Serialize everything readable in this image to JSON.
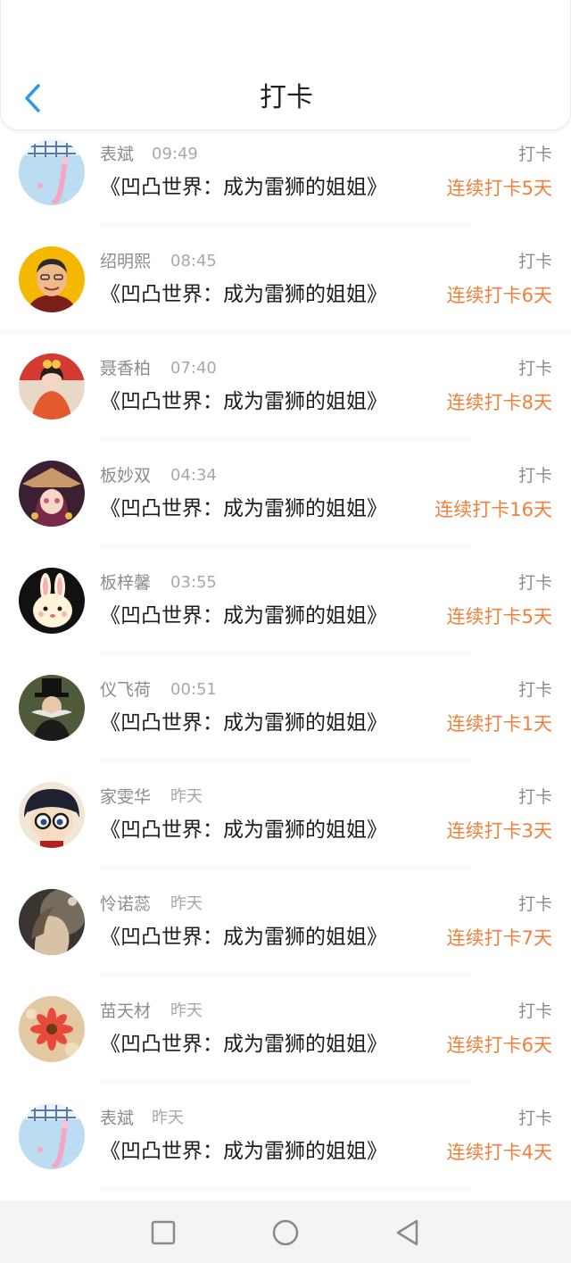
{
  "header": {
    "title": "打卡"
  },
  "colors": {
    "accent_orange": "#f0813c",
    "name_gray": "#8c8c8c",
    "back_blue": "#2b9be8"
  },
  "entries": [
    {
      "name": "表斌",
      "time": "09:49",
      "book": "《凹凸世界：成为雷狮的姐姐》",
      "action": "打卡",
      "streak": "连续打卡5天",
      "avatar_icon": "cherry-blossom-avatar"
    },
    {
      "name": "绍明熙",
      "time": "08:45",
      "book": "《凹凸世界：成为雷狮的姐姐》",
      "action": "打卡",
      "streak": "连续打卡6天",
      "avatar_icon": "cartoon-man-avatar"
    },
    {
      "name": "聂香柏",
      "time": "07:40",
      "book": "《凹凸世界：成为雷狮的姐姐》",
      "action": "打卡",
      "streak": "连续打卡8天",
      "avatar_icon": "doll-avatar"
    },
    {
      "name": "板妙双",
      "time": "04:34",
      "book": "《凹凸世界：成为雷狮的姐姐》",
      "action": "打卡",
      "streak": "连续打卡16天",
      "avatar_icon": "anime-girl-avatar"
    },
    {
      "name": "板梓馨",
      "time": "03:55",
      "book": "《凹凸世界：成为雷狮的姐姐》",
      "action": "打卡",
      "streak": "连续打卡5天",
      "avatar_icon": "bunny-avatar"
    },
    {
      "name": "仪飞荷",
      "time": "00:51",
      "book": "《凹凸世界：成为雷狮的姐姐》",
      "action": "打卡",
      "streak": "连续打卡1天",
      "avatar_icon": "top-hat-man-avatar"
    },
    {
      "name": "家雯华",
      "time": "昨天",
      "book": "《凹凸世界：成为雷狮的姐姐》",
      "action": "打卡",
      "streak": "连续打卡3天",
      "avatar_icon": "detective-avatar"
    },
    {
      "name": "怜诺蕊",
      "time": "昨天",
      "book": "《凹凸世界：成为雷狮的姐姐》",
      "action": "打卡",
      "streak": "连续打卡7天",
      "avatar_icon": "portrait-avatar"
    },
    {
      "name": "苗天材",
      "time": "昨天",
      "book": "《凹凸世界：成为雷狮的姐姐》",
      "action": "打卡",
      "streak": "连续打卡6天",
      "avatar_icon": "flower-avatar"
    },
    {
      "name": "表斌",
      "time": "昨天",
      "book": "《凹凸世界：成为雷狮的姐姐》",
      "action": "打卡",
      "streak": "连续打卡4天",
      "avatar_icon": "cherry-blossom-avatar"
    }
  ],
  "system_nav": {
    "recents_icon": "square-icon",
    "home_icon": "circle-icon",
    "back_icon": "triangle-back-icon"
  }
}
